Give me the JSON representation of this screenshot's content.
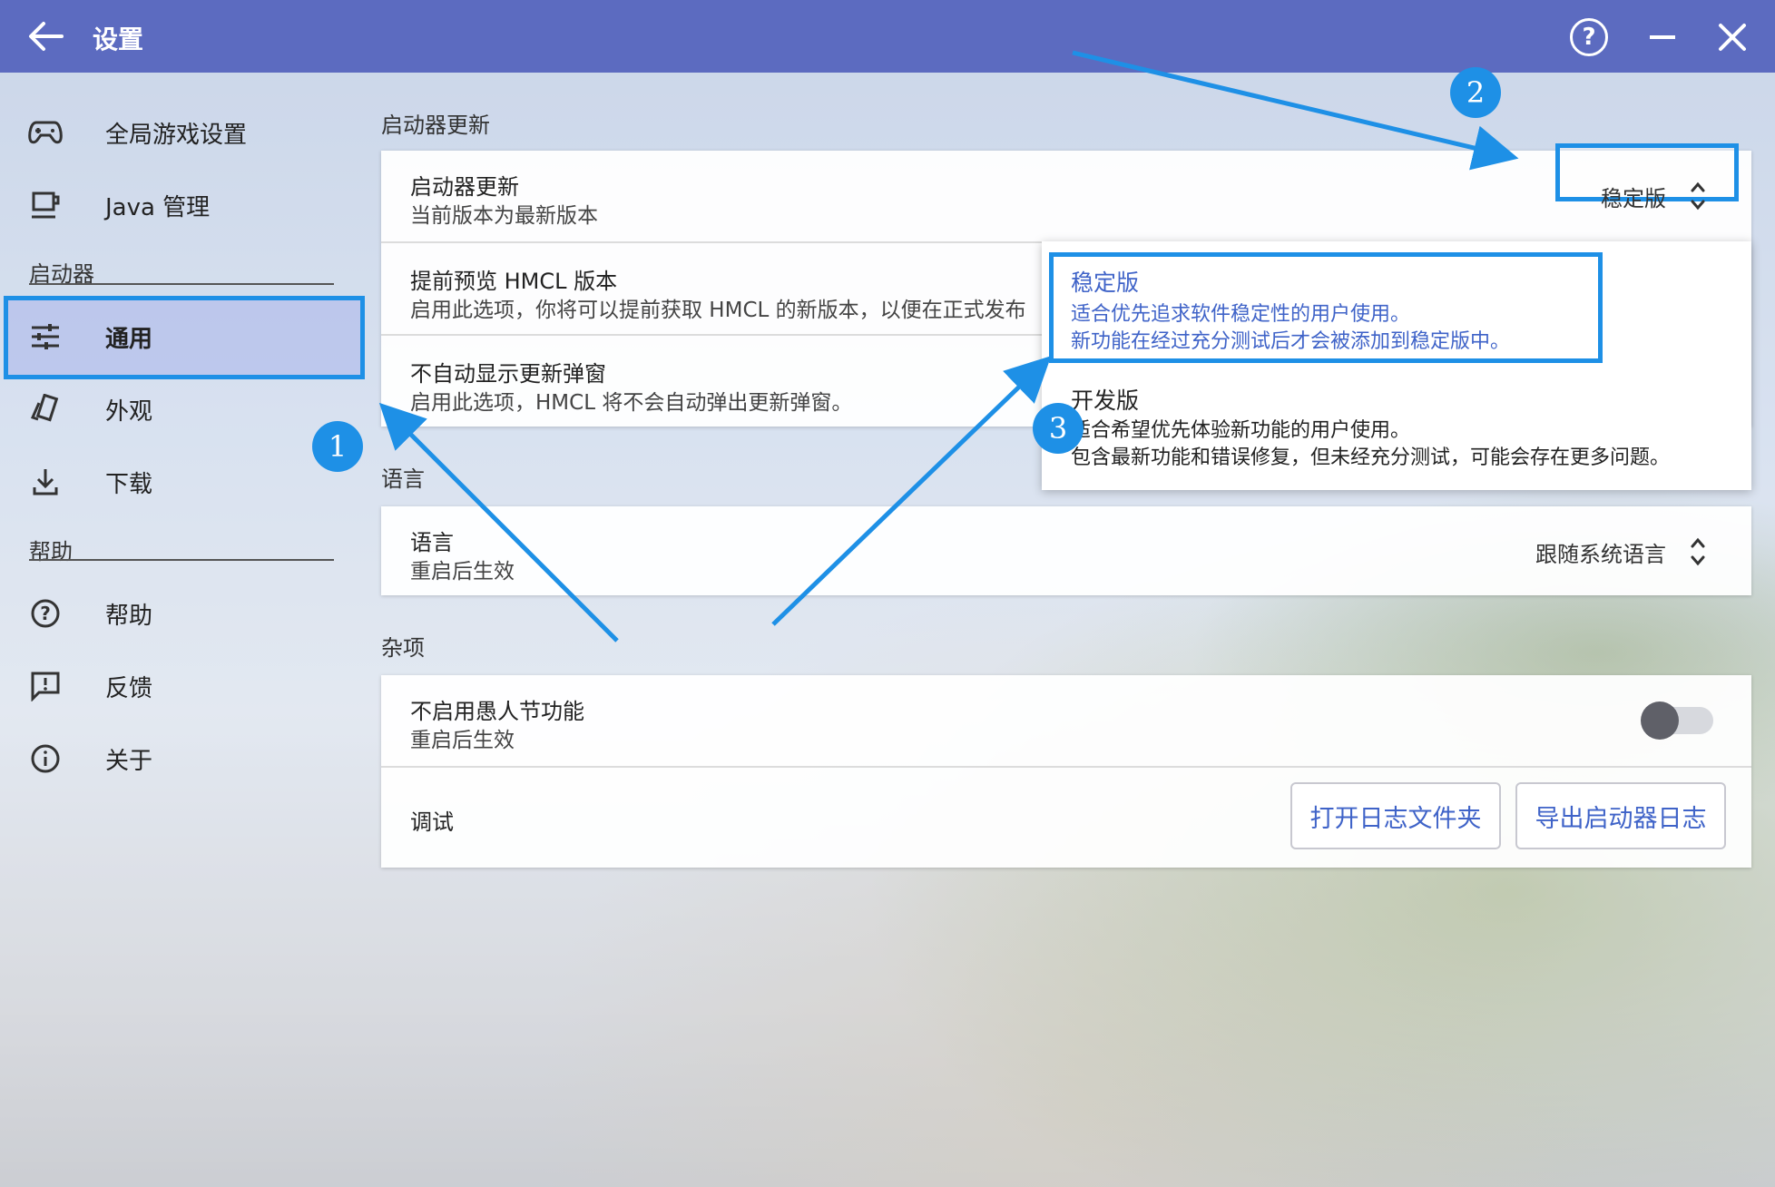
{
  "window": {
    "title": "设置"
  },
  "sidebar": {
    "top_items": [
      {
        "label": "全局游戏设置",
        "icon": "gamepad-icon"
      },
      {
        "label": "Java 管理",
        "icon": "java-icon"
      }
    ],
    "launcher_header": "启动器",
    "launcher_items": [
      {
        "label": "通用",
        "icon": "sliders-icon",
        "active": true
      },
      {
        "label": "外观",
        "icon": "palette-icon"
      },
      {
        "label": "下载",
        "icon": "download-icon"
      }
    ],
    "help_header": "帮助",
    "help_items": [
      {
        "label": "帮助",
        "icon": "help-circle-icon"
      },
      {
        "label": "反馈",
        "icon": "feedback-icon"
      },
      {
        "label": "关于",
        "icon": "info-icon"
      }
    ]
  },
  "update_section": {
    "title": "启动器更新",
    "channel_row": {
      "title": "启动器更新",
      "subtitle": "当前版本为最新版本",
      "value": "稳定版"
    },
    "preview_row": {
      "title": "提前预览 HMCL 版本",
      "subtitle": "启用此选项，你将可以提前获取 HMCL 的新版本，以便在正式发布"
    },
    "popup_row": {
      "title": "不自动显示更新弹窗",
      "subtitle": "启用此选项，HMCL 将不会自动弹出更新弹窗。"
    }
  },
  "channel_dropdown": {
    "options": [
      {
        "title": "稳定版",
        "line1": "适合优先追求软件稳定性的用户使用。",
        "line2": "新功能在经过充分测试后才会被添加到稳定版中。",
        "selected": true
      },
      {
        "title": "开发版",
        "line1": "适合希望优先体验新功能的用户使用。",
        "line2": "包含最新功能和错误修复，但未经充分测试，可能会存在更多问题。",
        "selected": false
      }
    ]
  },
  "language_section": {
    "title": "语言",
    "row": {
      "title": "语言",
      "subtitle": "重启后生效",
      "value": "跟随系统语言"
    }
  },
  "misc_section": {
    "title": "杂项",
    "april_fools": {
      "title": "不启用愚人节功能",
      "subtitle": "重启后生效",
      "enabled": false
    },
    "debug": {
      "title": "调试",
      "open_logs_button": "打开日志文件夹",
      "export_logs_button": "导出启动器日志"
    }
  },
  "annotations": {
    "badge1": "1",
    "badge2": "2",
    "badge3": "3"
  },
  "colors": {
    "titlebar": "#5c6bc0",
    "highlight": "#1e90e6",
    "link_blue": "#3f63c8"
  }
}
